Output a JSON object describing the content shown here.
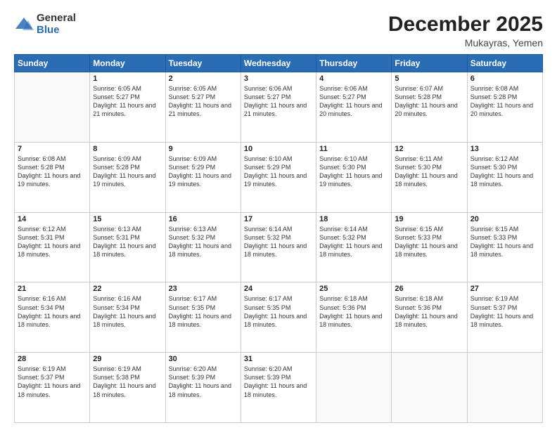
{
  "logo": {
    "general": "General",
    "blue": "Blue"
  },
  "title": {
    "month": "December 2025",
    "location": "Mukayras, Yemen"
  },
  "weekdays": [
    "Sunday",
    "Monday",
    "Tuesday",
    "Wednesday",
    "Thursday",
    "Friday",
    "Saturday"
  ],
  "weeks": [
    [
      {
        "day": "",
        "info": ""
      },
      {
        "day": "1",
        "info": "Sunrise: 6:05 AM\nSunset: 5:27 PM\nDaylight: 11 hours and 21 minutes."
      },
      {
        "day": "2",
        "info": "Sunrise: 6:05 AM\nSunset: 5:27 PM\nDaylight: 11 hours and 21 minutes."
      },
      {
        "day": "3",
        "info": "Sunrise: 6:06 AM\nSunset: 5:27 PM\nDaylight: 11 hours and 21 minutes."
      },
      {
        "day": "4",
        "info": "Sunrise: 6:06 AM\nSunset: 5:27 PM\nDaylight: 11 hours and 20 minutes."
      },
      {
        "day": "5",
        "info": "Sunrise: 6:07 AM\nSunset: 5:28 PM\nDaylight: 11 hours and 20 minutes."
      },
      {
        "day": "6",
        "info": "Sunrise: 6:08 AM\nSunset: 5:28 PM\nDaylight: 11 hours and 20 minutes."
      }
    ],
    [
      {
        "day": "7",
        "info": "Sunrise: 6:08 AM\nSunset: 5:28 PM\nDaylight: 11 hours and 19 minutes."
      },
      {
        "day": "8",
        "info": "Sunrise: 6:09 AM\nSunset: 5:28 PM\nDaylight: 11 hours and 19 minutes."
      },
      {
        "day": "9",
        "info": "Sunrise: 6:09 AM\nSunset: 5:29 PM\nDaylight: 11 hours and 19 minutes."
      },
      {
        "day": "10",
        "info": "Sunrise: 6:10 AM\nSunset: 5:29 PM\nDaylight: 11 hours and 19 minutes."
      },
      {
        "day": "11",
        "info": "Sunrise: 6:10 AM\nSunset: 5:30 PM\nDaylight: 11 hours and 19 minutes."
      },
      {
        "day": "12",
        "info": "Sunrise: 6:11 AM\nSunset: 5:30 PM\nDaylight: 11 hours and 18 minutes."
      },
      {
        "day": "13",
        "info": "Sunrise: 6:12 AM\nSunset: 5:30 PM\nDaylight: 11 hours and 18 minutes."
      }
    ],
    [
      {
        "day": "14",
        "info": "Sunrise: 6:12 AM\nSunset: 5:31 PM\nDaylight: 11 hours and 18 minutes."
      },
      {
        "day": "15",
        "info": "Sunrise: 6:13 AM\nSunset: 5:31 PM\nDaylight: 11 hours and 18 minutes."
      },
      {
        "day": "16",
        "info": "Sunrise: 6:13 AM\nSunset: 5:32 PM\nDaylight: 11 hours and 18 minutes."
      },
      {
        "day": "17",
        "info": "Sunrise: 6:14 AM\nSunset: 5:32 PM\nDaylight: 11 hours and 18 minutes."
      },
      {
        "day": "18",
        "info": "Sunrise: 6:14 AM\nSunset: 5:32 PM\nDaylight: 11 hours and 18 minutes."
      },
      {
        "day": "19",
        "info": "Sunrise: 6:15 AM\nSunset: 5:33 PM\nDaylight: 11 hours and 18 minutes."
      },
      {
        "day": "20",
        "info": "Sunrise: 6:15 AM\nSunset: 5:33 PM\nDaylight: 11 hours and 18 minutes."
      }
    ],
    [
      {
        "day": "21",
        "info": "Sunrise: 6:16 AM\nSunset: 5:34 PM\nDaylight: 11 hours and 18 minutes."
      },
      {
        "day": "22",
        "info": "Sunrise: 6:16 AM\nSunset: 5:34 PM\nDaylight: 11 hours and 18 minutes."
      },
      {
        "day": "23",
        "info": "Sunrise: 6:17 AM\nSunset: 5:35 PM\nDaylight: 11 hours and 18 minutes."
      },
      {
        "day": "24",
        "info": "Sunrise: 6:17 AM\nSunset: 5:35 PM\nDaylight: 11 hours and 18 minutes."
      },
      {
        "day": "25",
        "info": "Sunrise: 6:18 AM\nSunset: 5:36 PM\nDaylight: 11 hours and 18 minutes."
      },
      {
        "day": "26",
        "info": "Sunrise: 6:18 AM\nSunset: 5:36 PM\nDaylight: 11 hours and 18 minutes."
      },
      {
        "day": "27",
        "info": "Sunrise: 6:19 AM\nSunset: 5:37 PM\nDaylight: 11 hours and 18 minutes."
      }
    ],
    [
      {
        "day": "28",
        "info": "Sunrise: 6:19 AM\nSunset: 5:37 PM\nDaylight: 11 hours and 18 minutes."
      },
      {
        "day": "29",
        "info": "Sunrise: 6:19 AM\nSunset: 5:38 PM\nDaylight: 11 hours and 18 minutes."
      },
      {
        "day": "30",
        "info": "Sunrise: 6:20 AM\nSunset: 5:39 PM\nDaylight: 11 hours and 18 minutes."
      },
      {
        "day": "31",
        "info": "Sunrise: 6:20 AM\nSunset: 5:39 PM\nDaylight: 11 hours and 18 minutes."
      },
      {
        "day": "",
        "info": ""
      },
      {
        "day": "",
        "info": ""
      },
      {
        "day": "",
        "info": ""
      }
    ]
  ]
}
